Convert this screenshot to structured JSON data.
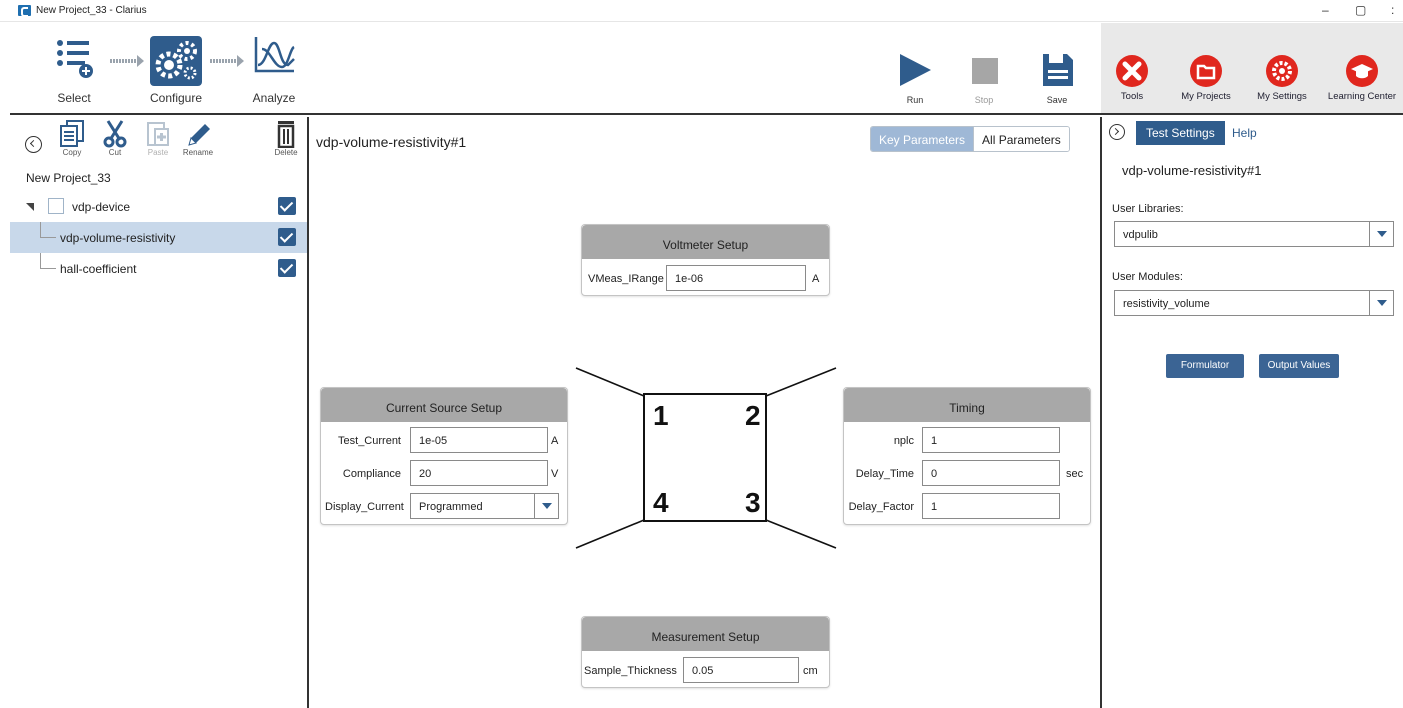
{
  "window": {
    "title": "New Project_33 - Clarius",
    "controls": [
      "–",
      "▢",
      ":"
    ]
  },
  "workflow": [
    {
      "label": "Select",
      "icon": "list-add-icon"
    },
    {
      "label": "Configure",
      "icon": "gears-icon"
    },
    {
      "label": "Analyze",
      "icon": "graph-icon"
    }
  ],
  "run_controls": [
    {
      "label": "Run",
      "icon": "play-icon",
      "color": "#2f5c8c"
    },
    {
      "label": "Stop",
      "icon": "stop-icon",
      "color": "#a6a6a6"
    },
    {
      "label": "Save",
      "icon": "save-icon",
      "color": "#2f5c8c"
    }
  ],
  "app_menu": [
    {
      "label": "Tools",
      "icon": "wrench-icon"
    },
    {
      "label": "My Projects",
      "icon": "folder-icon"
    },
    {
      "label": "My Settings",
      "icon": "gear-icon"
    },
    {
      "label": "Learning Center",
      "icon": "graduation-cap-icon"
    }
  ],
  "left_toolbar": [
    {
      "label": "Copy",
      "icon": "copy-icon",
      "enabled": true
    },
    {
      "label": "Cut",
      "icon": "scissors-icon",
      "enabled": true
    },
    {
      "label": "Paste",
      "icon": "paste-icon",
      "enabled": false
    },
    {
      "label": "Rename",
      "icon": "pencil-icon",
      "enabled": true
    },
    {
      "label": "Delete",
      "icon": "trash-icon",
      "enabled": true
    }
  ],
  "project": {
    "name": "New Project_33",
    "tree": [
      {
        "label": "vdp-device",
        "checked": true
      },
      {
        "label": "vdp-volume-resistivity",
        "checked": true,
        "selected": true
      },
      {
        "label": "hall-coefficient",
        "checked": true
      }
    ]
  },
  "center": {
    "title": "vdp-volume-resistivity#1",
    "toggle": {
      "key": "Key Parameters",
      "all": "All Parameters"
    },
    "voltmeter": {
      "title": "Voltmeter Setup",
      "fields": [
        {
          "label": "VMeas_IRange",
          "value": "1e-06",
          "unit": "A"
        }
      ]
    },
    "current_source": {
      "title": "Current Source Setup",
      "fields": [
        {
          "label": "Test_Current",
          "value": "1e-05",
          "unit": "A"
        },
        {
          "label": "Compliance",
          "value": "20",
          "unit": "V"
        },
        {
          "label": "Display_Current",
          "value": "Programmed",
          "unit": ""
        }
      ]
    },
    "timing": {
      "title": "Timing",
      "fields": [
        {
          "label": "nplc",
          "value": "1",
          "unit": ""
        },
        {
          "label": "Delay_Time",
          "value": "0",
          "unit": "sec"
        },
        {
          "label": "Delay_Factor",
          "value": "1",
          "unit": ""
        }
      ]
    },
    "measurement": {
      "title": "Measurement Setup",
      "fields": [
        {
          "label": "Sample_Thickness",
          "value": "0.05",
          "unit": "cm"
        }
      ]
    },
    "sample_terminals": [
      "1",
      "2",
      "4",
      "3"
    ]
  },
  "right": {
    "tabs": [
      "Test Settings",
      "Help"
    ],
    "title": "vdp-volume-resistivity#1",
    "user_libraries_label": "User Libraries:",
    "user_libraries_value": "vdpulib",
    "user_modules_label": "User Modules:",
    "user_modules_value": "resistivity_volume",
    "buttons": [
      "Formulator",
      "Output Values"
    ]
  },
  "colors": {
    "accent": "#2f5c8c",
    "danger": "#e0271e",
    "selection": "#c8d8ea",
    "card_header": "#a8a8a8"
  }
}
